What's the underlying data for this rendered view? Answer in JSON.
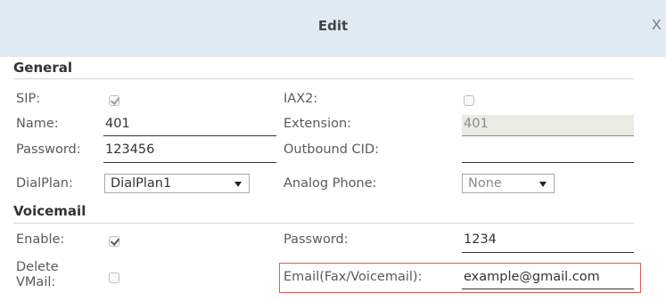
{
  "dialog": {
    "title": "Edit",
    "close_label": "X"
  },
  "general": {
    "heading": "General",
    "sip_label": "SIP:",
    "sip_checked": true,
    "iax2_label": "IAX2:",
    "iax2_checked": false,
    "name_label": "Name:",
    "name_value": "401",
    "extension_label": "Extension:",
    "extension_value": "401",
    "password_label": "Password:",
    "password_value": "123456",
    "outbound_cid_label": "Outbound CID:",
    "outbound_cid_value": "",
    "dialplan_label": "DialPlan:",
    "dialplan_value": "DialPlan1",
    "analog_phone_label": "Analog Phone:",
    "analog_phone_value": "None"
  },
  "voicemail": {
    "heading": "Voicemail",
    "enable_label": "Enable:",
    "enable_checked": true,
    "password_label": "Password:",
    "password_value": "1234",
    "delete_label_line1": "Delete",
    "delete_label_line2": "VMail:",
    "delete_checked": false,
    "email_label": "Email(Fax/Voicemail):",
    "email_value": "example@gmail.com"
  },
  "colors": {
    "title_bar": "#dfeaf3",
    "highlight_border": "#e05a5a",
    "readonly_field": "#ebebe4"
  }
}
